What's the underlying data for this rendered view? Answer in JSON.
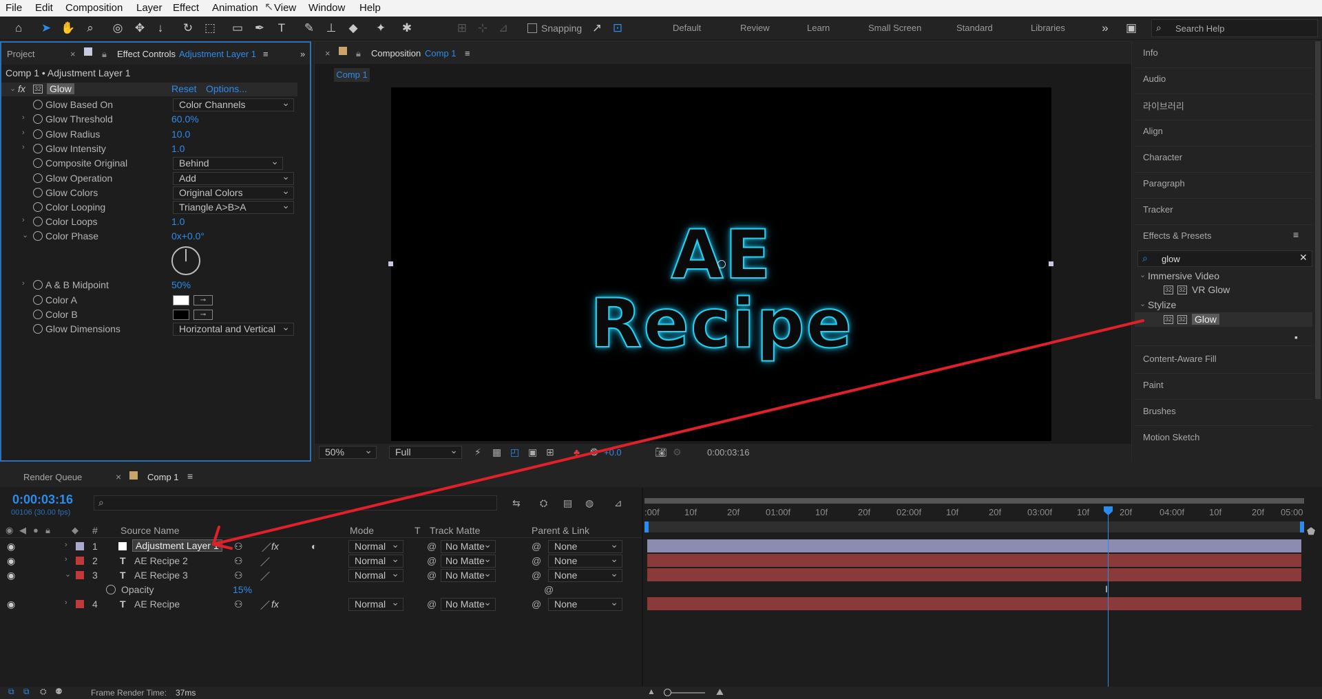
{
  "menu": [
    "File",
    "Edit",
    "Composition",
    "Layer",
    "Effect",
    "Animation",
    "View",
    "Window",
    "Help"
  ],
  "toolbar": {
    "snapping": "Snapping",
    "workspaces": [
      "Default",
      "Review",
      "Learn",
      "Small Screen",
      "Standard",
      "Libraries"
    ],
    "search_placeholder": "Search Help"
  },
  "left_panel": {
    "tab_project": "Project",
    "tab_effect_controls": "Effect Controls",
    "tab_layer": "Adjustment Layer 1",
    "breadcrumb": "Comp 1 • Adjustment Layer 1",
    "effect_name": "Glow",
    "reset": "Reset",
    "options": "Options...",
    "props": [
      {
        "name": "Glow Based On",
        "value": "Color Channels"
      },
      {
        "name": "Glow Threshold",
        "value": "60.0%"
      },
      {
        "name": "Glow Radius",
        "value": "10.0"
      },
      {
        "name": "Glow Intensity",
        "value": "1.0"
      },
      {
        "name": "Composite Original",
        "value": "Behind"
      },
      {
        "name": "Glow Operation",
        "value": "Add"
      },
      {
        "name": "Glow Colors",
        "value": "Original Colors"
      },
      {
        "name": "Color Looping",
        "value": "Triangle A>B>A"
      },
      {
        "name": "Color Loops",
        "value": "1.0"
      },
      {
        "name": "Color Phase",
        "value": "0x+0.0°"
      },
      {
        "name": "A & B Midpoint",
        "value": "50%"
      },
      {
        "name": "Color A",
        "value": ""
      },
      {
        "name": "Color B",
        "value": ""
      },
      {
        "name": "Glow Dimensions",
        "value": "Horizontal and Vertical"
      }
    ]
  },
  "comp_panel": {
    "tab": "Composition",
    "tab_comp": "Comp 1",
    "subtab": "Comp 1",
    "text": "AE Recipe",
    "zoom": "50%",
    "quality": "Full",
    "exposure": "+0.0",
    "timecode": "0:00:03:16"
  },
  "right_panel": {
    "items": [
      "Info",
      "Audio",
      "라이브러리",
      "Align",
      "Character",
      "Paragraph",
      "Tracker",
      "Effects & Presets"
    ],
    "search_value": "glow",
    "tree": [
      {
        "group": "Immersive Video",
        "item": "VR Glow"
      },
      {
        "group": "Stylize",
        "item": "Glow"
      }
    ],
    "lower_items": [
      "Content-Aware Fill",
      "Paint",
      "Brushes",
      "Motion Sketch"
    ]
  },
  "timeline": {
    "tab_render": "Render Queue",
    "tab_comp": "Comp 1",
    "timecode": "0:00:03:16",
    "frame_info": "00106 (30.00 fps)",
    "columns": {
      "num": "#",
      "source": "Source Name",
      "mode": "Mode",
      "t": "T",
      "track_matte": "Track Matte",
      "parent": "Parent & Link"
    },
    "ruler": [
      ":00f",
      "10f",
      "20f",
      "01:00f",
      "10f",
      "20f",
      "02:00f",
      "10f",
      "20f",
      "03:00f",
      "10f",
      "20f",
      "04:00f",
      "10f",
      "20f",
      "05:00"
    ],
    "layers": [
      {
        "num": "1",
        "name": "Adjustment Layer 1",
        "mode": "Normal",
        "matte": "No Matte",
        "parent": "None"
      },
      {
        "num": "2",
        "name": "AE Recipe 2",
        "mode": "Normal",
        "matte": "No Matte",
        "parent": "None"
      },
      {
        "num": "3",
        "name": "AE Recipe 3",
        "mode": "Normal",
        "matte": "No Matte",
        "parent": "None"
      },
      {
        "num": "4",
        "name": "AE Recipe",
        "mode": "Normal",
        "matte": "No Matte",
        "parent": "None"
      }
    ],
    "opacity_label": "Opacity",
    "opacity_value": "15%",
    "render_time_label": "Frame Render Time:",
    "render_time_value": "37ms"
  },
  "colors": {
    "accent": "#2d8ceb",
    "glow": "#29c9e6",
    "layer_red": "#8b3a3a",
    "layer_purple": "#8c8cb0",
    "arrow": "#e0202a"
  }
}
